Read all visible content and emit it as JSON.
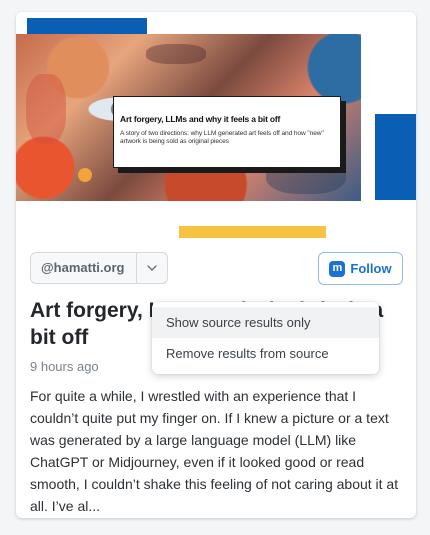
{
  "card": {
    "image": {
      "title": "Art forgery, LLMs and why it feels a bit off",
      "subtitle": "A story of two directions: why LLM generated art feels off and how \"new\" artwork is being sold as original pieces"
    },
    "source_handle": "@hamatti.org",
    "follow_label": "Follow",
    "headline": "Art forgery, LLMs and why it feels a bit off",
    "time": "9 hours ago",
    "excerpt": "For quite a while, I wrestled with an experience that I couldn’t quite put my finger on. If I knew a picture or a text was generated by a large language model (LLM) like ChatGPT or Midjourney, even if it looked good or read smooth, I couldn’t shake this feeling of not caring about it at all. I’ve al..."
  },
  "dropdown": {
    "items": [
      {
        "label": "Show source results only"
      },
      {
        "label": "Remove results from source"
      }
    ]
  },
  "icons": {
    "caret": "chevron-down-icon",
    "follow": "mastodon-icon"
  },
  "colors": {
    "accent_blue": "#0a5fb4",
    "accent_yellow": "#f6c343",
    "follow_blue": "#1a73d2"
  }
}
